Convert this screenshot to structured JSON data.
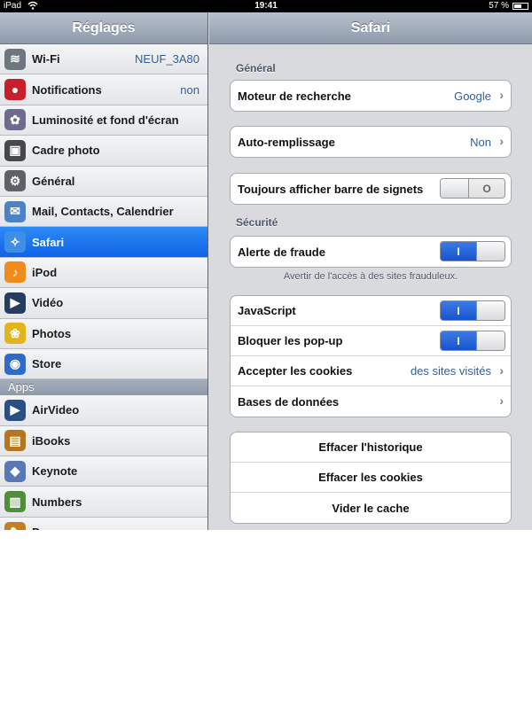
{
  "status": {
    "carrier": "iPad",
    "time": "19:41",
    "battery": "57 %",
    "battery_level": 0.57
  },
  "left": {
    "title": "Réglages",
    "items": [
      {
        "label": "Wi-Fi",
        "value": "NEUF_3A80",
        "icon": "wifi-icon",
        "color": "#6f7680"
      },
      {
        "label": "Notifications",
        "value": "non",
        "icon": "notifications-icon",
        "color": "#c8202a"
      },
      {
        "label": "Luminosité et fond d'écran",
        "value": "",
        "icon": "brightness-icon",
        "color": "#6f6b8f"
      },
      {
        "label": "Cadre photo",
        "value": "",
        "icon": "photo-frame-icon",
        "color": "#47484c"
      },
      {
        "label": "Général",
        "value": "",
        "icon": "gear-icon",
        "color": "#5d6168"
      },
      {
        "label": "Mail, Contacts, Calendrier",
        "value": "",
        "icon": "mail-icon",
        "color": "#4b82c8"
      },
      {
        "label": "Safari",
        "value": "",
        "icon": "safari-icon",
        "color": "#3f8ee6"
      },
      {
        "label": "iPod",
        "value": "",
        "icon": "ipod-icon",
        "color": "#f08c1c"
      },
      {
        "label": "Vidéo",
        "value": "",
        "icon": "video-icon",
        "color": "#263d62"
      },
      {
        "label": "Photos",
        "value": "",
        "icon": "photos-icon",
        "color": "#e2b51f"
      },
      {
        "label": "Store",
        "value": "",
        "icon": "store-icon",
        "color": "#2e6cc8"
      }
    ],
    "apps_header": "Apps",
    "apps": [
      {
        "label": "AirVideo",
        "icon": "airvideo-icon",
        "color": "#2a4f82"
      },
      {
        "label": "iBooks",
        "icon": "ibooks-icon",
        "color": "#b4761e"
      },
      {
        "label": "Keynote",
        "icon": "keynote-icon",
        "color": "#5a79b4"
      },
      {
        "label": "Numbers",
        "icon": "numbers-icon",
        "color": "#4f8e3a"
      },
      {
        "label": "Pages",
        "icon": "pages-icon",
        "color": "#c67d1d"
      }
    ]
  },
  "right": {
    "title": "Safari",
    "general_header": "Général",
    "search_engine": {
      "label": "Moteur de recherche",
      "value": "Google"
    },
    "autofill": {
      "label": "Auto-remplissage",
      "value": "Non"
    },
    "bookmarks_bar": {
      "label": "Toujours afficher barre de signets",
      "toggle": "O"
    },
    "security_header": "Sécurité",
    "fraud": {
      "label": "Alerte de fraude",
      "toggle": "I"
    },
    "fraud_note": "Avertir de l'accès à des sites frauduleux.",
    "javascript": {
      "label": "JavaScript",
      "toggle": "I"
    },
    "popups": {
      "label": "Bloquer les pop-up",
      "toggle": "I"
    },
    "cookies": {
      "label": "Accepter les cookies",
      "value": "des sites visités"
    },
    "databases": {
      "label": "Bases de données"
    },
    "clear_history": "Effacer l'historique",
    "clear_cookies": "Effacer les cookies",
    "clear_cache": "Vider le cache"
  }
}
